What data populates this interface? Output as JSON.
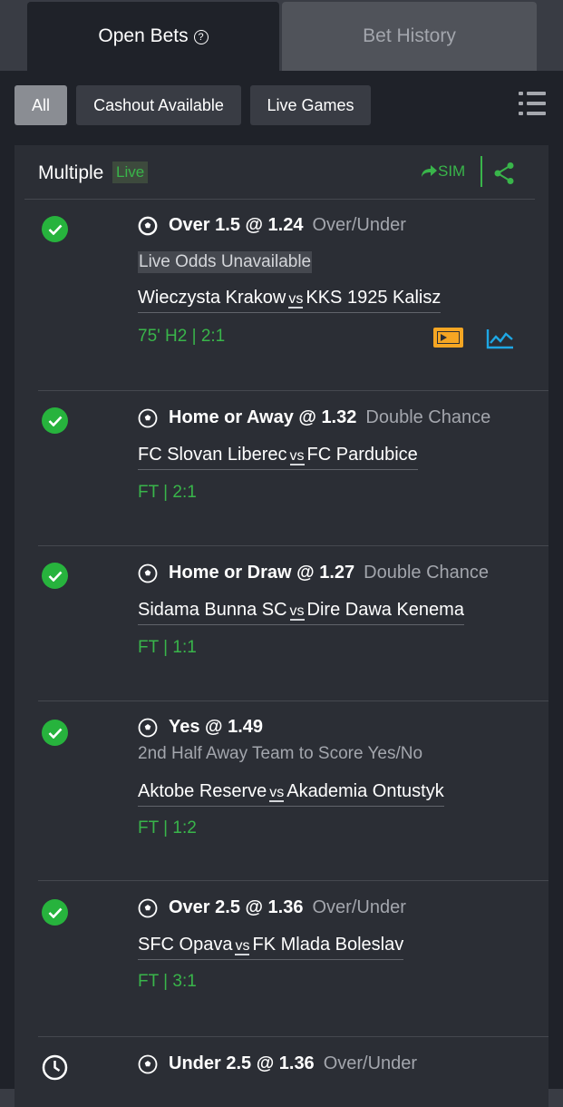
{
  "tabs": [
    {
      "label": "Open Bets",
      "active": true,
      "icon": "help-icon"
    },
    {
      "label": "Bet History",
      "active": false
    }
  ],
  "filters": [
    {
      "label": "All",
      "active": true
    },
    {
      "label": "Cashout Available",
      "active": false
    },
    {
      "label": "Live Games",
      "active": false
    }
  ],
  "filter_menu_icon": "list-menu-icon",
  "bet": {
    "type_label": "Multiple",
    "live_badge": "Live",
    "sim_label": "SIM",
    "share_icon": "share-icon",
    "legs": [
      {
        "status_icon": "check-icon",
        "selection": "Over 1.5 @ 1.24",
        "market": "Over/Under",
        "odds_note": "Live Odds Unavailable",
        "home": "Wieczysta Krakow",
        "vs": "vs",
        "away": "KKS 1925 Kalisz",
        "status_prefix": "75' H2 | ",
        "score": "2:1",
        "has_stream": true
      },
      {
        "status_icon": "check-icon",
        "selection": "Home or Away @ 1.32",
        "market": "Double Chance",
        "home": "FC Slovan Liberec",
        "vs": "vs",
        "away": "FC Pardubice",
        "status_prefix": "FT | ",
        "score": "2:1"
      },
      {
        "status_icon": "check-icon",
        "selection": "Home or Draw @ 1.27",
        "market": "Double Chance",
        "home": "Sidama Bunna SC",
        "vs": "vs",
        "away": "Dire Dawa Kenema",
        "status_prefix": "FT | ",
        "score": "1:1"
      },
      {
        "status_icon": "check-icon",
        "selection": "Yes @ 1.49",
        "market": "2nd Half Away Team to Score Yes/No",
        "home": "Aktobe Reserve",
        "vs": "vs",
        "away": "Akademia Ontustyk",
        "status_prefix": "FT | ",
        "score": "1:2"
      },
      {
        "status_icon": "check-icon",
        "selection": "Over 2.5 @ 1.36",
        "market": "Over/Under",
        "home": "SFC Opava",
        "vs": "vs",
        "away": "FK Mlada Boleslav",
        "status_prefix": "FT | ",
        "score": "3:1"
      },
      {
        "status_icon": "clock-icon",
        "selection": "Under 2.5 @ 1.36",
        "market": "Over/Under"
      }
    ]
  },
  "colors": {
    "background": "#1f2229",
    "card": "#2b2e35",
    "accent_green": "#39b54a",
    "check_green": "#27b33d",
    "stream_orange": "#f5a623",
    "stats_blue": "#1ea7e4"
  }
}
